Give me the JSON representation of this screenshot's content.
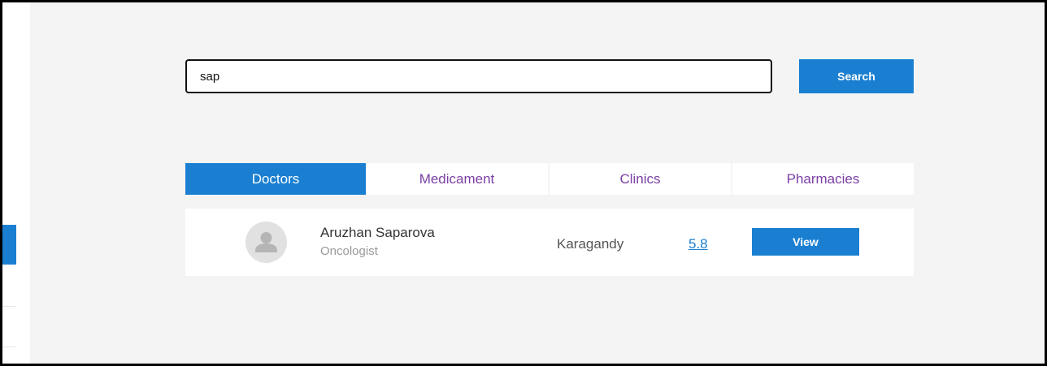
{
  "search": {
    "value": "sap",
    "button_label": "Search"
  },
  "tabs": [
    {
      "label": "Doctors",
      "active": true
    },
    {
      "label": "Medicament",
      "active": false
    },
    {
      "label": "Clinics",
      "active": false
    },
    {
      "label": "Pharmacies",
      "active": false
    }
  ],
  "results": [
    {
      "avatar_icon": "user-placeholder-icon",
      "name": "Aruzhan Saparova",
      "specialty": "Oncologist",
      "city": "Karagandy",
      "rating": "5.8",
      "action_label": "View"
    }
  ],
  "colors": {
    "accent": "#1b7fd1",
    "tab_text": "#7b3fa6",
    "background": "#f4f4f4"
  }
}
